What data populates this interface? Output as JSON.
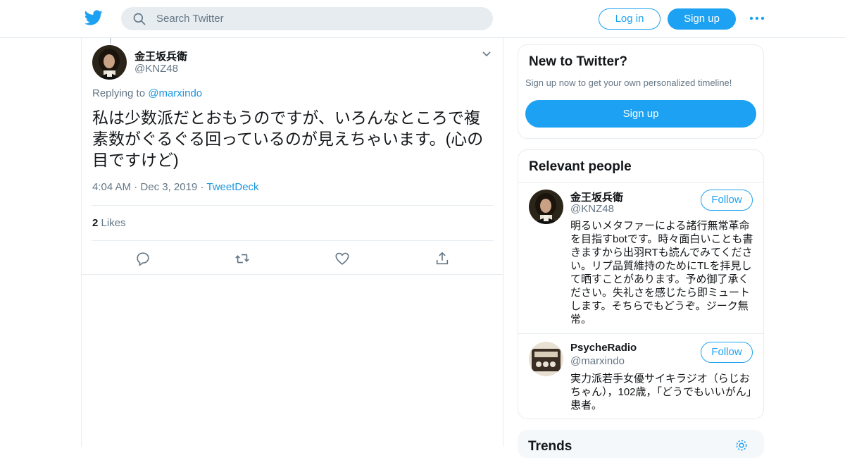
{
  "header": {
    "search_placeholder": "Search Twitter",
    "login_label": "Log in",
    "signup_label": "Sign up"
  },
  "tweet": {
    "author_name": "金王坂兵衛",
    "author_handle": "@KNZ48",
    "replying_prefix": "Replying to",
    "replying_handle": "@marxindo",
    "text": "私は少数派だとおもうのですが、いろんなところで複素数がぐるぐる回っているのが見えちゃいます。(心の目ですけど)",
    "time": "4:04 AM",
    "date": "Dec 3, 2019",
    "source": "TweetDeck",
    "likes_count": "2",
    "likes_label": "Likes"
  },
  "sidebar": {
    "new_to_twitter": {
      "title": "New to Twitter?",
      "subtitle": "Sign up now to get your own personalized timeline!",
      "button": "Sign up"
    },
    "relevant_people": {
      "title": "Relevant people",
      "follow_label": "Follow",
      "people": [
        {
          "name": "金王坂兵衛",
          "handle": "@KNZ48",
          "bio": "明るいメタファーによる諸行無常革命を目指すbotです。時々面白いことも書きますから出羽RTも読んでみてください。リプ品質維持のためにTLを拝見して晒すことがあります。予め御了承ください。失礼さを感じたら即ミュートします。そちらでもどうぞ。ジーク無常。"
        },
        {
          "name": "PsycheRadio",
          "handle": "@marxindo",
          "bio": "実力派若手女優サイキラジオ（らじおちゃん），102歳，「どうでもいいがん」患者。"
        }
      ]
    },
    "trends": {
      "title": "Trends"
    }
  },
  "colors": {
    "accent": "#1da1f2",
    "link": "#1b95e0",
    "muted": "#657786"
  }
}
